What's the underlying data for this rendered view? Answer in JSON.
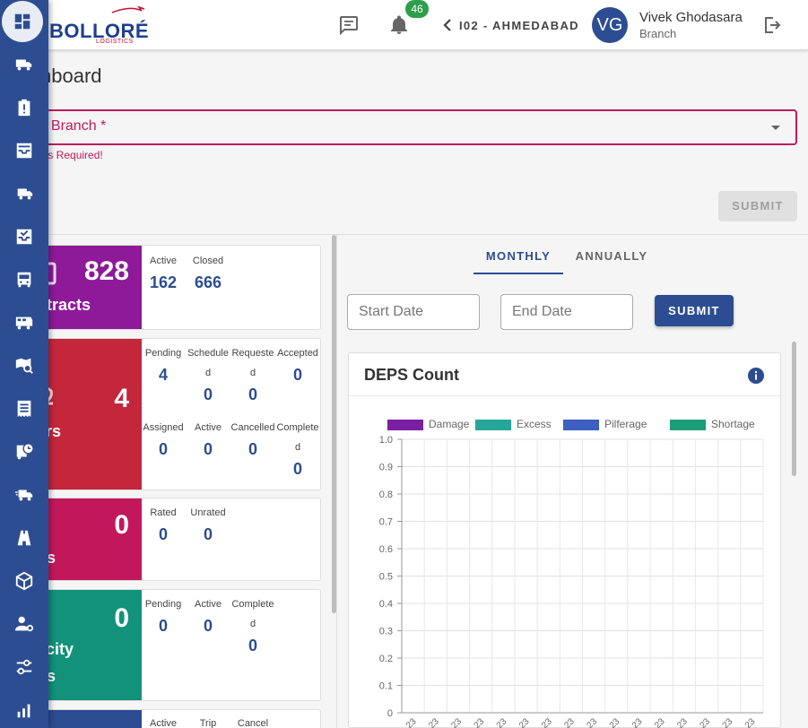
{
  "header": {
    "logo_text": "BOLLORÉ",
    "logo_sub": "LOGISTICS",
    "notification_count": "46",
    "branch": "I02 - AHMEDABAD",
    "user_initials": "VG",
    "user_name": "Vivek Ghodasara",
    "user_role": "Branch"
  },
  "page": {
    "title": "nboard",
    "select_label": "ct Branch *",
    "error": "h Is Required!",
    "submit_label": "SUBMIT"
  },
  "cards": [
    {
      "total": "828",
      "title": "ntracts",
      "color": "#8e1a9a",
      "stats": [
        {
          "label": "Active",
          "value": "162"
        },
        {
          "label": "Closed",
          "value": "666"
        }
      ]
    },
    {
      "total": "4",
      "title": "ers",
      "color": "#c4263b",
      "stats": [
        {
          "label": "Pending",
          "value": "4"
        },
        {
          "label": "Scheduled",
          "value": "0"
        },
        {
          "label": "Requested",
          "value": "0"
        },
        {
          "label": "Accepted",
          "value": "0"
        },
        {
          "label": "Assigned",
          "value": "0"
        },
        {
          "label": "Active",
          "value": "0"
        },
        {
          "label": "Cancelled",
          "value": "0"
        },
        {
          "label": "Completed",
          "value": "0"
        }
      ]
    },
    {
      "total": "0",
      "title": "os",
      "color": "#c2185b",
      "stats": [
        {
          "label": "Rated",
          "value": "0"
        },
        {
          "label": "Unrated",
          "value": "0"
        }
      ]
    },
    {
      "total": "0",
      "title": "acity",
      "title2": "os",
      "color": "#12927a",
      "stats": [
        {
          "label": "Pending",
          "value": "0"
        },
        {
          "label": "Active",
          "value": "0"
        },
        {
          "label": "Completed",
          "value": "0"
        }
      ]
    },
    {
      "color": "#2d4d92",
      "stats": [
        {
          "label": "Active"
        },
        {
          "label": "Trip"
        },
        {
          "label": "Cancel"
        }
      ]
    }
  ],
  "right": {
    "tab_monthly": "MONTHLY",
    "tab_annual": "ANNUALLY",
    "start_date": "Start Date",
    "end_date": "End Date",
    "submit_label": "SUBMIT",
    "chart_title": "DEPS Count"
  },
  "chart_data": {
    "type": "bar",
    "title": "DEPS Count",
    "series": [
      {
        "name": "Damage",
        "color": "#7b1fa2",
        "values": []
      },
      {
        "name": "Excess",
        "color": "#26a69a",
        "values": []
      },
      {
        "name": "Pilferage",
        "color": "#3c5fc0",
        "values": []
      },
      {
        "name": "Shortage",
        "color": "#1b9e77",
        "values": []
      }
    ],
    "ylim": [
      0,
      1.0
    ],
    "yticks": [
      "0",
      "0.1",
      "0.2",
      "0.3",
      "0.4",
      "0.5",
      "0.6",
      "0.7",
      "0.8",
      "0.9",
      "1.0"
    ],
    "x_tick_count": 16,
    "x_tick_label": "23",
    "grid": true,
    "legend": "top"
  },
  "sidebar": {
    "items": [
      "dashboard",
      "truck-check",
      "clipboard-alert",
      "inbox-tray",
      "truck-fast",
      "inbox-check",
      "bus",
      "rv",
      "map-search",
      "receipt",
      "bus-clock",
      "truck-delivery",
      "road",
      "cube",
      "user-gear",
      "sliders",
      "chart"
    ]
  }
}
